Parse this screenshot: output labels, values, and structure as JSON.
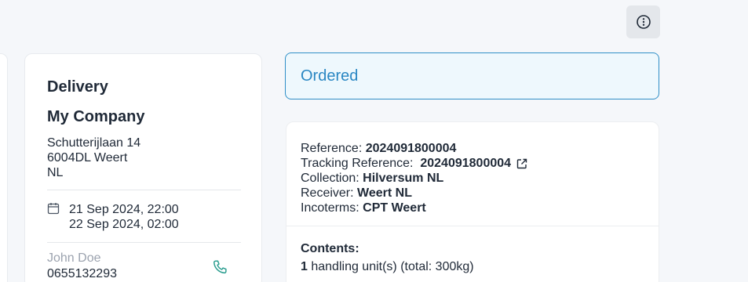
{
  "toolbar": {
    "more_icon": "more-vertical-circle-icon"
  },
  "delivery": {
    "title": "Delivery",
    "company": "My Company",
    "address_line1": "Schutterijlaan 14",
    "address_line2": "6004DL Weert",
    "address_line3": "NL",
    "date_start": "21 Sep 2024, 22:00",
    "date_end": "22 Sep 2024, 02:00",
    "contact_name": "John Doe",
    "contact_phone": "0655132293",
    "calendar_icon": "calendar-icon",
    "phone_icon": "phone-icon"
  },
  "status": {
    "label": "Ordered",
    "color": "#2a87c3"
  },
  "details": {
    "reference_label": "Reference:",
    "reference_value": "2024091800004",
    "tracking_label": "Tracking Reference:",
    "tracking_value": "2024091800004",
    "collection_label": "Collection:",
    "collection_value": "Hilversum NL",
    "receiver_label": "Receiver:",
    "receiver_value": "Weert NL",
    "incoterms_label": "Incoterms:",
    "incoterms_value": "CPT Weert",
    "contents_label": "Contents:",
    "contents_count": "1",
    "contents_text": "handling unit(s) (total: 300kg)"
  }
}
